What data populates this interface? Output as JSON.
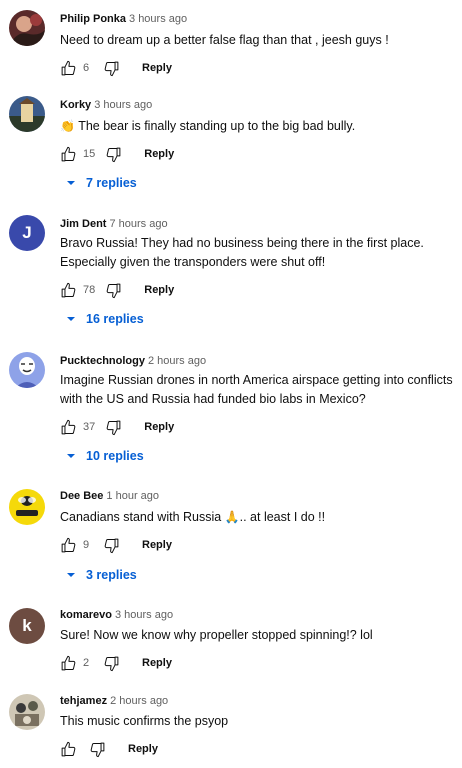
{
  "comments": [
    {
      "author": "Philip Ponka",
      "time": "3 hours ago",
      "text": "Need to dream up a better false flag than that , jeesh guys !",
      "likes": "6",
      "reply_label": "Reply",
      "avatar": "photo-avatar"
    },
    {
      "author": "Korky",
      "time": "3 hours ago",
      "text_emoji": "👏",
      "text": "The bear is finally standing up to the big bad bully.",
      "likes": "15",
      "reply_label": "Reply",
      "replies": "7 replies",
      "avatar": "photo-avatar"
    },
    {
      "author": "Jim Dent",
      "time": "7 hours ago",
      "text_lines": [
        "Bravo Russia! They had no business being there in the first place.",
        "Especially given the transponders were shut off!"
      ],
      "likes": "78",
      "reply_label": "Reply",
      "replies": "16 replies",
      "avatar_letter": "J",
      "avatar_color": "#3949ab"
    },
    {
      "author": "Pucktechnology",
      "time": "2 hours ago",
      "text_lines": [
        "Imagine Russian drones in north America airspace getting into conflicts",
        "with the US and Russia had funded bio labs in Mexico?"
      ],
      "likes": "37",
      "reply_label": "Reply",
      "replies": "10 replies",
      "avatar": "mask-avatar"
    },
    {
      "author": "Dee Bee",
      "time": "1 hour ago",
      "text_before": "Canadians stand with Russia ",
      "text_emoji": "🙏",
      "text_after": ".. at least I do !!",
      "likes": "9",
      "reply_label": "Reply",
      "replies": "3 replies",
      "avatar": "bee-avatar"
    },
    {
      "author": "komarevo",
      "time": "3 hours ago",
      "text": "Sure! Now we know why propeller stopped spinning!?  lol",
      "likes": "2",
      "reply_label": "Reply",
      "avatar_letter": "k",
      "avatar_color": "#6d4c41"
    },
    {
      "author": "tehjamez",
      "time": "2 hours ago",
      "text": "This music confirms the psyop",
      "likes": "",
      "reply_label": "Reply",
      "avatar": "photo-avatar"
    }
  ],
  "colors": {
    "link": "#065fd4",
    "meta": "#606060"
  }
}
